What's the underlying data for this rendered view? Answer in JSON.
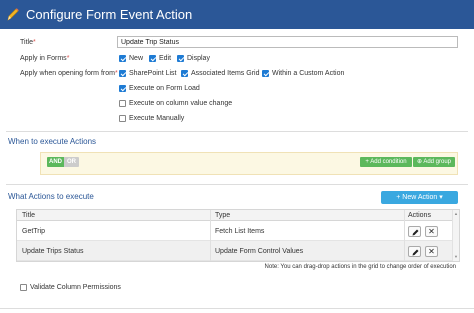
{
  "header": {
    "title": "Configure Form Event Action",
    "icon": "pencil-icon",
    "bg_color": "#2b5797"
  },
  "form": {
    "title_label": "Title",
    "title_value": "Update Trip Status",
    "apply_forms_label": "Apply in Forms",
    "apply_forms_options": [
      {
        "label": "New",
        "checked": true
      },
      {
        "label": "Edit",
        "checked": true
      },
      {
        "label": "Display",
        "checked": true
      }
    ],
    "apply_opening_label": "Apply when opening form from",
    "opening_options": [
      {
        "label": "SharePoint List",
        "checked": true
      },
      {
        "label": "Associated Items Grid",
        "checked": true
      },
      {
        "label": "Within a Custom Action",
        "checked": true
      }
    ],
    "execute_options": [
      {
        "label": "Execute on Form Load",
        "checked": true
      },
      {
        "label": "Execute on column value change",
        "checked": false
      },
      {
        "label": "Execute Manually",
        "checked": false
      }
    ]
  },
  "when_section": {
    "title": "When to execute Actions",
    "and_label": "AND",
    "or_label": "OR",
    "add_condition_label": "Add condition",
    "add_group_label": "Add group"
  },
  "actions_section": {
    "title": "What Actions to execute",
    "new_action_label": "New Action",
    "columns": [
      "Title",
      "Type",
      "Actions"
    ],
    "rows": [
      {
        "title": "GetTrip",
        "type": "Fetch List Items"
      },
      {
        "title": "Update Trips Status",
        "type": "Update Form Control Values"
      }
    ],
    "note": "Note: You can drag-drop actions in the grid to change order of execution"
  },
  "validate": {
    "label": "Validate Column Permissions",
    "checked": false
  },
  "colors": {
    "accent": "#3aa8e0",
    "success": "#5cb85c",
    "checkbox": "#1e7bd4",
    "section_title": "#2b5797"
  }
}
